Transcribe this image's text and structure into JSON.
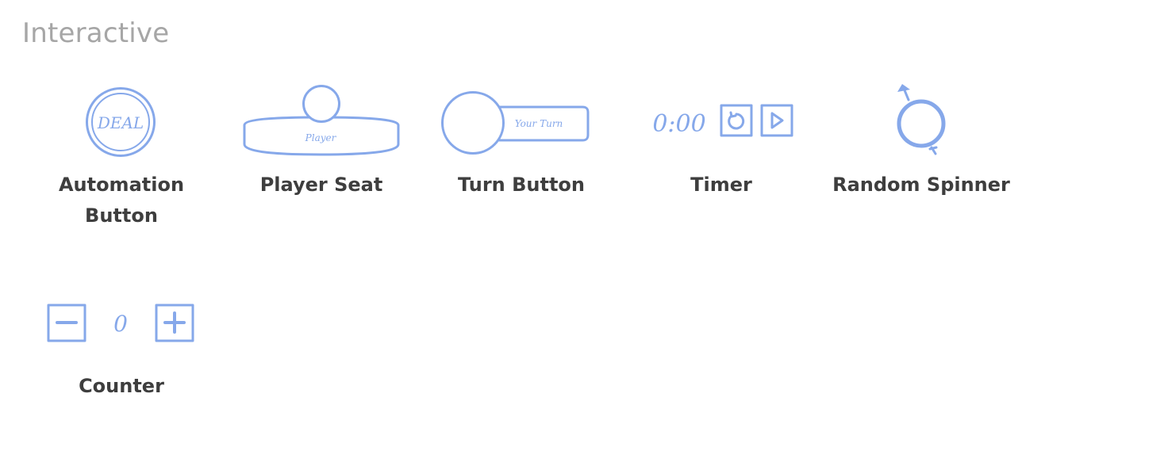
{
  "section": {
    "title": "Interactive"
  },
  "colors": {
    "sketch_stroke": "#86a8ea",
    "label_text": "#3e3e3e",
    "section_title": "#a6a6a6",
    "background": "#ffffff"
  },
  "components": {
    "automation_button": {
      "label_line1": "Automation",
      "label_line2": "Button",
      "icon_text": "DEAL",
      "icon": "double-circle-button-icon"
    },
    "player_seat": {
      "label": "Player Seat",
      "icon_text": "Player",
      "icon": "player-seat-icon"
    },
    "turn_button": {
      "label": "Turn Button",
      "icon_text": "Your Turn",
      "icon": "turn-button-icon"
    },
    "timer": {
      "label": "Timer",
      "time": "0:00",
      "icons": [
        "reset-icon",
        "play-icon"
      ]
    },
    "random_spinner": {
      "label": "Random Spinner",
      "icon": "spinner-icon"
    },
    "counter": {
      "label": "Counter",
      "value": "0",
      "icons": [
        "minus-icon",
        "plus-icon"
      ]
    }
  }
}
